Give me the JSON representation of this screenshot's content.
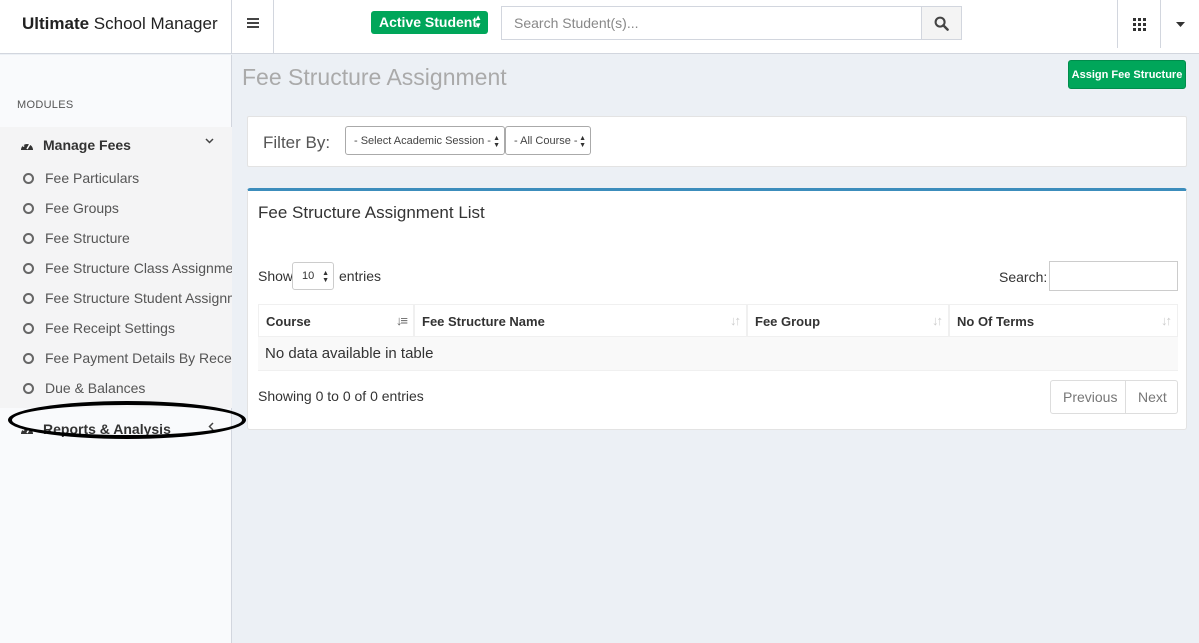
{
  "brand": {
    "strong": "Ultimate",
    "rest": " School Manager"
  },
  "header": {
    "student_filter": "Active Student",
    "search_placeholder": "Search Student(s)..."
  },
  "sidebar": {
    "section_label": "MODULES",
    "manage_fees": {
      "label": "Manage Fees",
      "items": [
        {
          "label": "Fee Particulars"
        },
        {
          "label": "Fee Groups"
        },
        {
          "label": "Fee Structure"
        },
        {
          "label": "Fee Structure Class Assignment"
        },
        {
          "label": "Fee Structure Student Assignment"
        },
        {
          "label": "Fee Receipt Settings"
        },
        {
          "label": "Fee Payment Details By Receipt"
        },
        {
          "label": "Due & Balances"
        }
      ]
    },
    "reports": {
      "label": "Reports & Analysis"
    }
  },
  "page": {
    "title": "Fee Structure Assignment",
    "assign_button": "Assign Fee Structure"
  },
  "filter": {
    "label": "Filter By:",
    "session": "- Select Academic Session -",
    "course": "- All Course -"
  },
  "list": {
    "title": "Fee Structure Assignment List",
    "show_label": "Show",
    "page_length": "10",
    "entries_label": "entries",
    "search_label": "Search:",
    "columns": [
      {
        "label": "Course"
      },
      {
        "label": "Fee Structure Name"
      },
      {
        "label": "Fee Group"
      },
      {
        "label": "No Of Terms"
      }
    ],
    "empty_message": "No data available in table",
    "info": "Showing 0 to 0 of 0 entries",
    "prev": "Previous",
    "next": "Next"
  },
  "colors": {
    "accent": "#00a65a",
    "box_top": "#3c8dbc"
  }
}
